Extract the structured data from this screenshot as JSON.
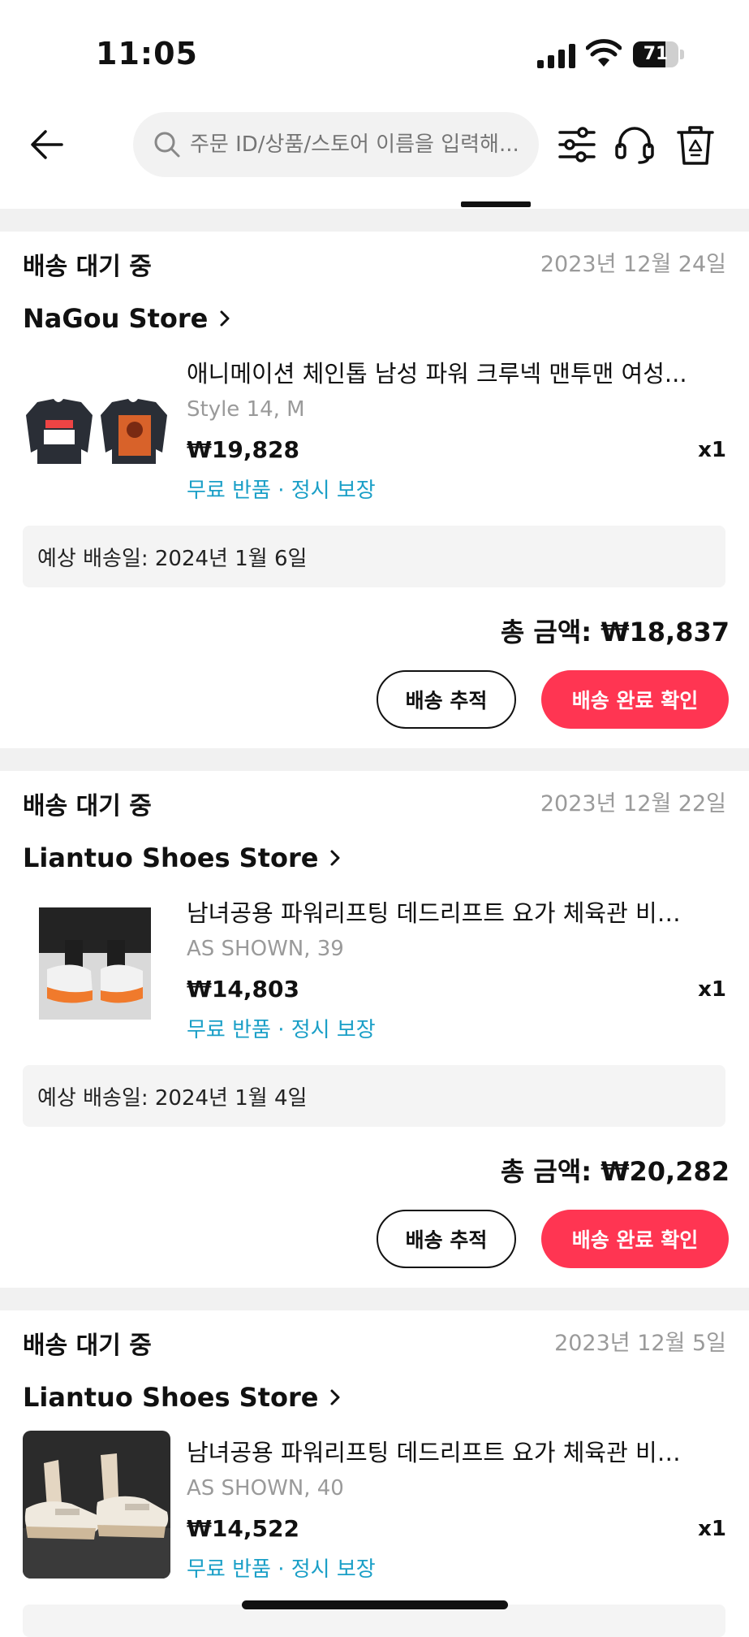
{
  "status_bar": {
    "time": "11:05",
    "battery": "71",
    "battery_level": 0.71
  },
  "header": {
    "search_placeholder": "주문 ID/상품/스토어 이름을 입력해..."
  },
  "orders": [
    {
      "status": "배송 대기 중",
      "date": "2023년 12월 24일",
      "store": "NaGou Store",
      "product_title": "애니메이션 체인톱 남성 파워 크루넥 맨투맨 여성...",
      "variant": "Style 14, M",
      "price": "₩19,828",
      "qty": "x1",
      "service": "무료 반품 · 정시 보장",
      "delivery": "예상 배송일: 2024년 1월 6일",
      "total": "총 금액: ₩18,837",
      "track_label": "배송 추적",
      "confirm_label": "배송 완료 확인"
    },
    {
      "status": "배송 대기 중",
      "date": "2023년 12월 22일",
      "store": "Liantuo Shoes Store",
      "product_title": "남녀공용 파워리프팅 데드리프트 요가 체육관 비…",
      "variant": "AS SHOWN, 39",
      "price": "₩14,803",
      "qty": "x1",
      "service": "무료 반품 · 정시 보장",
      "delivery": "예상 배송일: 2024년 1월 4일",
      "total": "총 금액: ₩20,282",
      "track_label": "배송 추적",
      "confirm_label": "배송 완료 확인"
    },
    {
      "status": "배송 대기 중",
      "date": "2023년 12월 5일",
      "store": "Liantuo Shoes Store",
      "product_title": "남녀공용 파워리프팅 데드리프트 요가 체육관 비…",
      "variant": "AS SHOWN, 40",
      "price": "₩14,522",
      "qty": "x1",
      "service": "무료 반품 · 정시 보장"
    }
  ],
  "colors": {
    "accent": "#ff3552",
    "service_text": "#1a9fc7",
    "muted": "#9a9a9a",
    "band": "#f1f1f1"
  }
}
